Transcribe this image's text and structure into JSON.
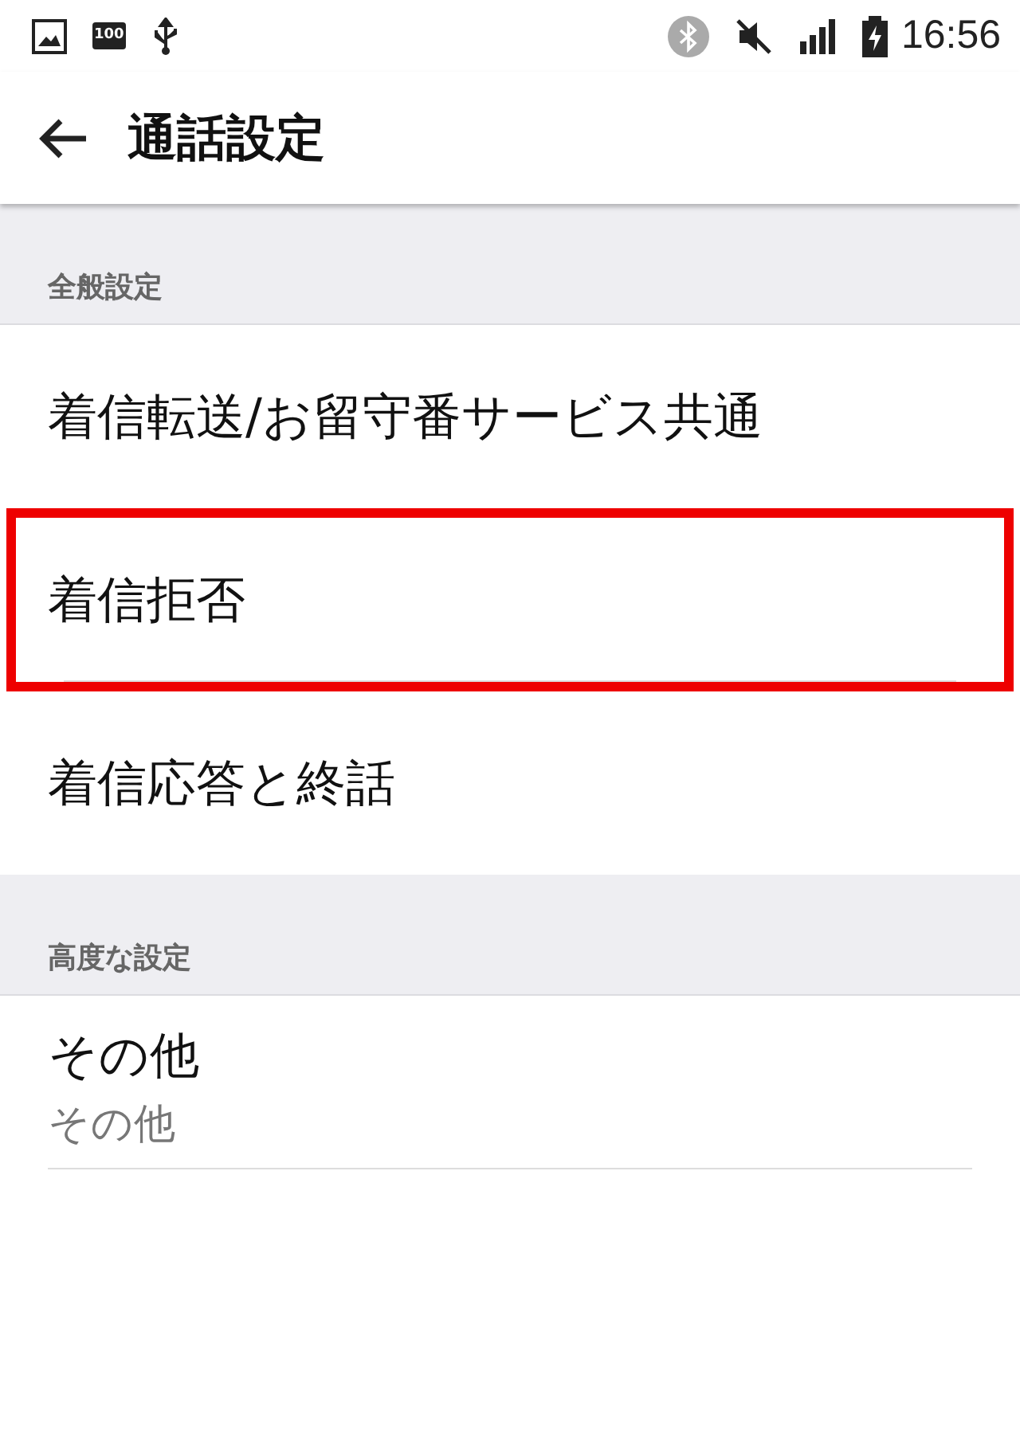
{
  "status_bar": {
    "battery_badge": "100",
    "time": "16:56"
  },
  "app_bar": {
    "title": "通話設定"
  },
  "sections": [
    {
      "header": "全般設定",
      "items": [
        {
          "title": "着信転送/お留守番サービス共通",
          "highlighted": false
        },
        {
          "title": "着信拒否",
          "highlighted": true
        },
        {
          "title": "着信応答と終話",
          "highlighted": false
        }
      ]
    },
    {
      "header": "高度な設定",
      "items": [
        {
          "title": "その他",
          "summary": "その他",
          "highlighted": false
        }
      ]
    }
  ]
}
